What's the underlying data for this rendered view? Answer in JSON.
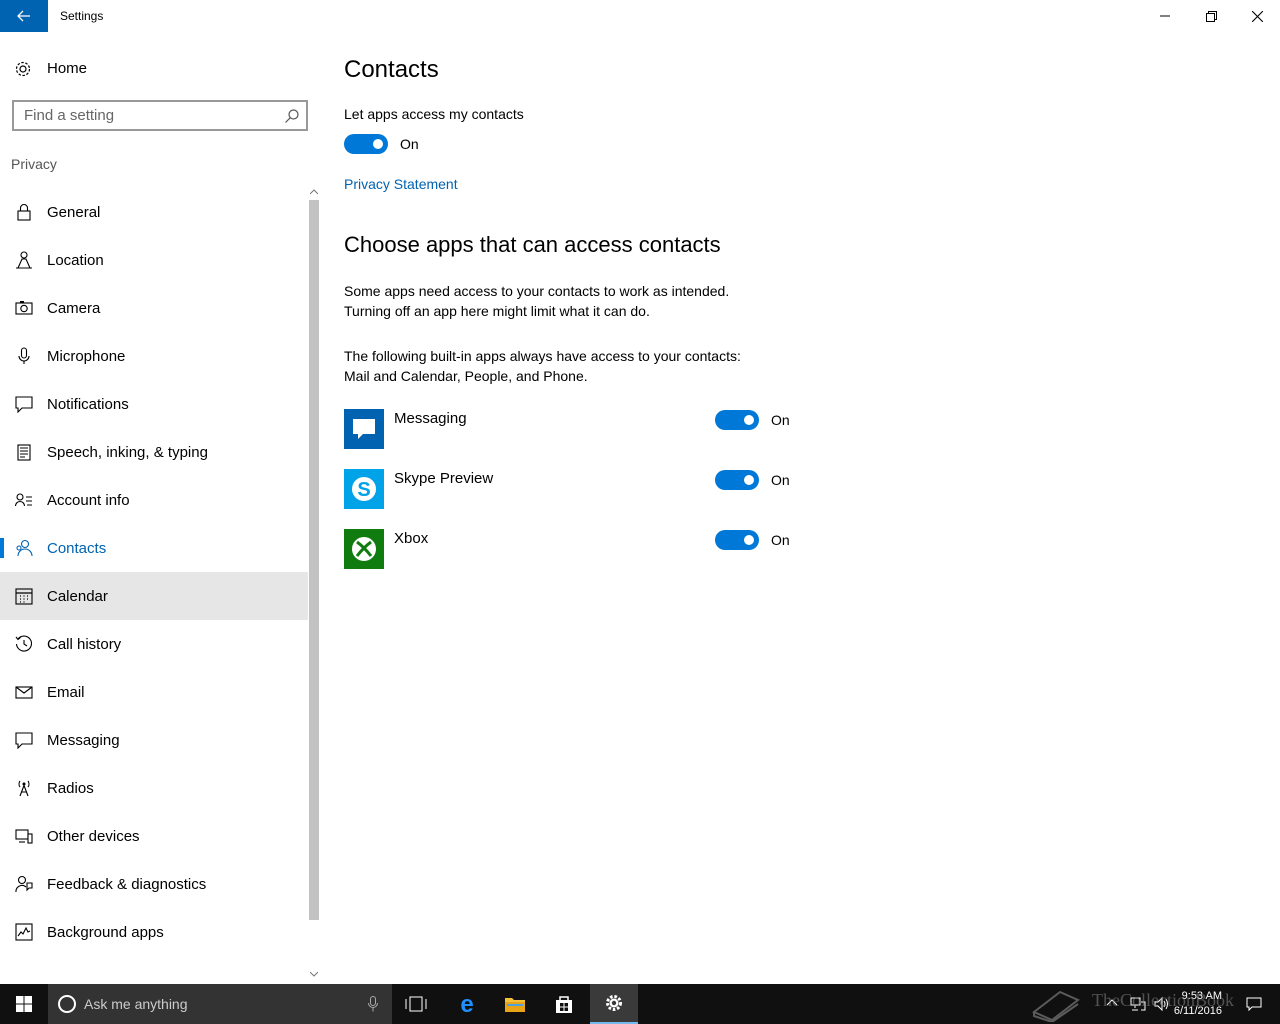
{
  "window": {
    "title": "Settings"
  },
  "sidebar": {
    "home_label": "Home",
    "search_placeholder": "Find a setting",
    "section_label": "Privacy",
    "items": [
      {
        "label": "General",
        "icon": "lock-icon"
      },
      {
        "label": "Location",
        "icon": "location-person-icon"
      },
      {
        "label": "Camera",
        "icon": "camera-icon"
      },
      {
        "label": "Microphone",
        "icon": "microphone-icon"
      },
      {
        "label": "Notifications",
        "icon": "notification-icon"
      },
      {
        "label": "Speech, inking, & typing",
        "icon": "speech-icon"
      },
      {
        "label": "Account info",
        "icon": "account-info-icon"
      },
      {
        "label": "Contacts",
        "icon": "contacts-icon",
        "selected": true
      },
      {
        "label": "Calendar",
        "icon": "calendar-icon",
        "hover": true
      },
      {
        "label": "Call history",
        "icon": "history-icon"
      },
      {
        "label": "Email",
        "icon": "mail-icon"
      },
      {
        "label": "Messaging",
        "icon": "message-icon"
      },
      {
        "label": "Radios",
        "icon": "radio-icon"
      },
      {
        "label": "Other devices",
        "icon": "devices-icon"
      },
      {
        "label": "Feedback & diagnostics",
        "icon": "feedback-icon"
      },
      {
        "label": "Background apps",
        "icon": "background-apps-icon"
      }
    ]
  },
  "main": {
    "title": "Contacts",
    "access_label": "Let apps access my contacts",
    "access_state": "On",
    "privacy_link": "Privacy Statement",
    "choose_title": "Choose apps that can access contacts",
    "para1_line1": "Some apps need access to your contacts to work as intended.",
    "para1_line2": "Turning off an app here might limit what it can do.",
    "para2_line1": "The following built-in apps always have access to your contacts:",
    "para2_line2": "Mail and Calendar, People, and Phone.",
    "apps": [
      {
        "name": "Messaging",
        "state": "On",
        "color": "#0063b1",
        "icon": "messaging-app-icon"
      },
      {
        "name": "Skype Preview",
        "state": "On",
        "color": "#00a2e8",
        "icon": "skype-app-icon"
      },
      {
        "name": "Xbox",
        "state": "On",
        "color": "#107c10",
        "icon": "xbox-app-icon"
      }
    ]
  },
  "taskbar": {
    "search_text": "Ask me anything",
    "time": "9:53 AM",
    "date": "6/11/2016",
    "watermark": "TheCollectionBook"
  },
  "colors": {
    "accent": "#0078d7",
    "link": "#0063b1"
  }
}
